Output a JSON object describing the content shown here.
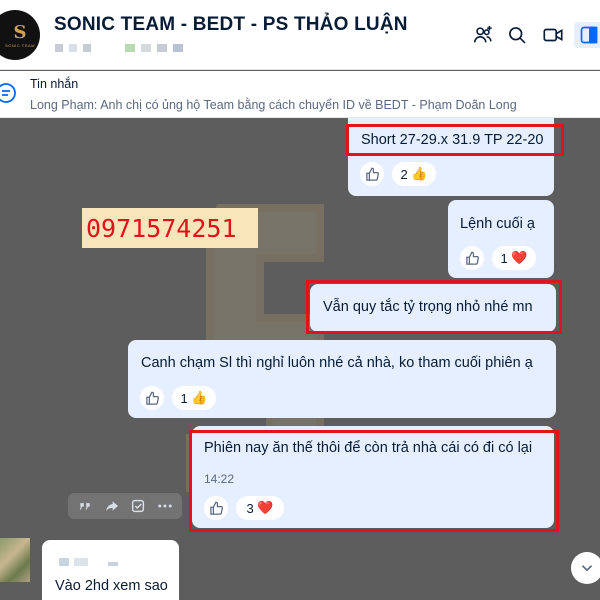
{
  "header": {
    "title": "SONIC TEAM - BEDT - PS THẢO LUẬN",
    "avatar_letter": "S",
    "avatar_caption": "SONIC TEAM",
    "icons": [
      "add-member-icon",
      "search-icon",
      "video-call-icon",
      "sidebar-toggle-icon"
    ],
    "active_icon_color": "#0068ff"
  },
  "pinned": {
    "title": "Tin nhắn",
    "text": "Long Phạm: Anh chị có ủng hộ Team bằng cách chuyển ID về BEDT - Phạm Doãn Long"
  },
  "watermark_phone": "0971574251",
  "messages": [
    {
      "text": "Short 27-29.x 31.9 TP 22-20",
      "reaction_count": "2",
      "reaction_emoji": "👍",
      "highlighted": true
    },
    {
      "text": "Lệnh cuối ạ",
      "reaction_count": "1",
      "reaction_emoji": "❤️",
      "highlighted": false
    },
    {
      "text": "Vẫn quy tắc tỷ trọng nhỏ nhé mn",
      "highlighted": true
    },
    {
      "text": "Canh chạm Sl thì nghỉ luôn nhé cả nhà, ko tham cuối phiên ạ",
      "reaction_count": "1",
      "reaction_emoji": "👍",
      "highlighted": false
    },
    {
      "text": "Phiên nay ăn thế thôi để còn trả nhà cái có đi có lại",
      "time": "14:22",
      "reaction_count": "3",
      "reaction_emoji": "❤️",
      "highlighted": true
    },
    {
      "text": "Vào 2hd xem sao",
      "sender": "incoming"
    }
  ],
  "message_tools": [
    "quote-icon",
    "forward-icon",
    "task-icon",
    "more-icon"
  ],
  "colors": {
    "bubble": "#e5efff",
    "highlight": "#e0141c",
    "chat_bg": "#5d5d5d",
    "phone_text": "#e3111c",
    "phone_bg": "#f6e6b9"
  }
}
